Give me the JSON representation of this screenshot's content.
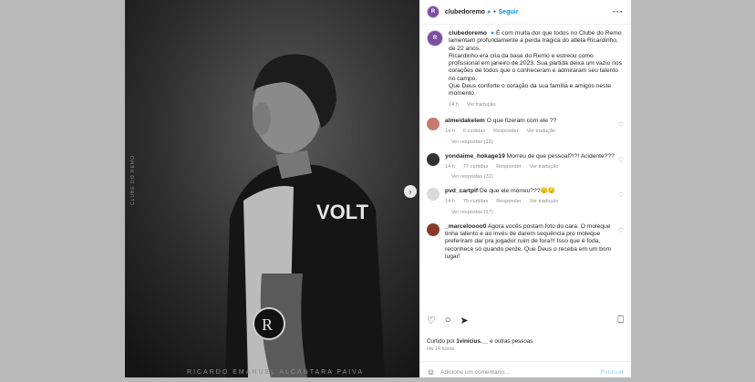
{
  "post": {
    "account": "clubedoremo",
    "follow_label": "Seguir",
    "caption_lines": [
      "É com muita dor que todos no Clube do Remo lamentam profundamente a perda trágica do atleta Ricardinho, de 22 anos.",
      "Ricardinho era cria da base do Remo e estreou como profissional em janeiro de 2023. Sua partida deixa um vazio nos corações de todos que o conheceram e admiraram seu talento no campo.",
      "Que Deus conforte o coração da sua família e amigos neste momento."
    ],
    "caption_time": "14 h",
    "see_translation": "Ver tradução",
    "photo_caption": "RICARDO EMANUEL ALCANTARA PAIVA"
  },
  "comments": [
    {
      "user": "almeidakelem",
      "text": "O que fizeram com ele ??",
      "time": "14 h",
      "likes": "6 curtidas",
      "reply": "Responder",
      "translate": "Ver tradução",
      "replies": "Ver respostas (15)"
    },
    {
      "user": "yondaime_hokage19",
      "text": "Morreu de que pessoal?!?! Acidente???",
      "time": "14 h",
      "likes": "77 curtidas",
      "reply": "Responder",
      "translate": "Ver tradução",
      "replies": "Ver respostas (31)"
    },
    {
      "user": "pvd_cartplf",
      "text": "De que ele morreu???😔😔",
      "time": "14 h",
      "likes": "75 curtidas",
      "reply": "Responder",
      "translate": "Ver tradução",
      "replies": "Ver respostas (17)"
    },
    {
      "user": "_marceloooo0",
      "text": "Agora vocês postam foto do cara. O moleque tinha talento e ao invés de darem sequência pro moleque preferiram dar pra jogador ruim de fora!!! Isso que é foda, reconhece só quando perde. Que Deus o receba em um bom lugar!"
    }
  ],
  "footer": {
    "liked_by_prefix": "Curtido por",
    "liked_by_user": "1vinicius.__",
    "liked_by_suffix": "e outras pessoas",
    "ago": "Há 14 horas",
    "add_comment_placeholder": "Adicione um comentário...",
    "publish": "Publicar"
  }
}
